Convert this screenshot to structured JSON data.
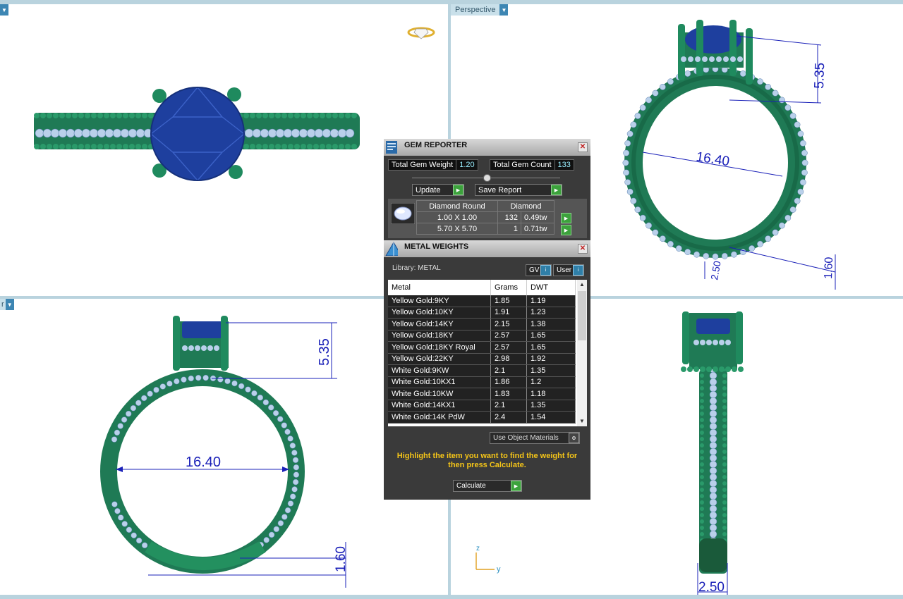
{
  "viewports": {
    "perspective_label": "Perspective",
    "left_label": "r"
  },
  "dimensions": {
    "prong_height": "5.35",
    "inner_diameter": "16.40",
    "band_height": "1.60",
    "band_width": "2.50",
    "band_width_persp": "2.50",
    "band_height_persp": "1.60"
  },
  "axes": {
    "z": "z",
    "y": "y"
  },
  "gem_reporter": {
    "title": "GEM REPORTER",
    "total_weight_label": "Total Gem Weight",
    "total_weight": "1.20",
    "total_count_label": "Total Gem Count",
    "total_count": "133",
    "update_label": "Update",
    "save_label": "Save Report",
    "shape_header": "Diamond Round",
    "material_header": "Diamond",
    "rows": [
      {
        "size": "1.00 X 1.00",
        "count": "132",
        "weight": "0.49tw"
      },
      {
        "size": "5.70 X 5.70",
        "count": "1",
        "weight": "0.71tw"
      }
    ]
  },
  "metal_weights": {
    "title": "METAL WEIGHTS",
    "library_label": "Library: METAL",
    "gv_label": "GV",
    "user_label": "User",
    "columns": [
      "Metal",
      "Grams",
      "DWT"
    ],
    "rows": [
      {
        "metal": "Yellow Gold:9KY",
        "grams": "1.85",
        "dwt": "1.19"
      },
      {
        "metal": "Yellow Gold:10KY",
        "grams": "1.91",
        "dwt": "1.23"
      },
      {
        "metal": "Yellow Gold:14KY",
        "grams": "2.15",
        "dwt": "1.38"
      },
      {
        "metal": "Yellow Gold:18KY",
        "grams": "2.57",
        "dwt": "1.65"
      },
      {
        "metal": "Yellow Gold:18KY Royal",
        "grams": "2.57",
        "dwt": "1.65"
      },
      {
        "metal": "Yellow Gold:22KY",
        "grams": "2.98",
        "dwt": "1.92"
      },
      {
        "metal": "White Gold:9KW",
        "grams": "2.1",
        "dwt": "1.35"
      },
      {
        "metal": "White Gold:10KX1",
        "grams": "1.86",
        "dwt": "1.2"
      },
      {
        "metal": "White Gold:10KW",
        "grams": "1.83",
        "dwt": "1.18"
      },
      {
        "metal": "White Gold:14KX1",
        "grams": "2.1",
        "dwt": "1.35"
      },
      {
        "metal": "White Gold:14K PdW",
        "grams": "2.4",
        "dwt": "1.54"
      }
    ],
    "use_object_materials": "Use Object Materials",
    "hint": "Highlight the item you want to find the weight for then press Calculate.",
    "calculate_label": "Calculate"
  },
  "colors": {
    "metal": "#1f7a55",
    "gem": "#1e3f9e",
    "melee": "#b9d0ea",
    "dimension": "#1a20b8"
  }
}
